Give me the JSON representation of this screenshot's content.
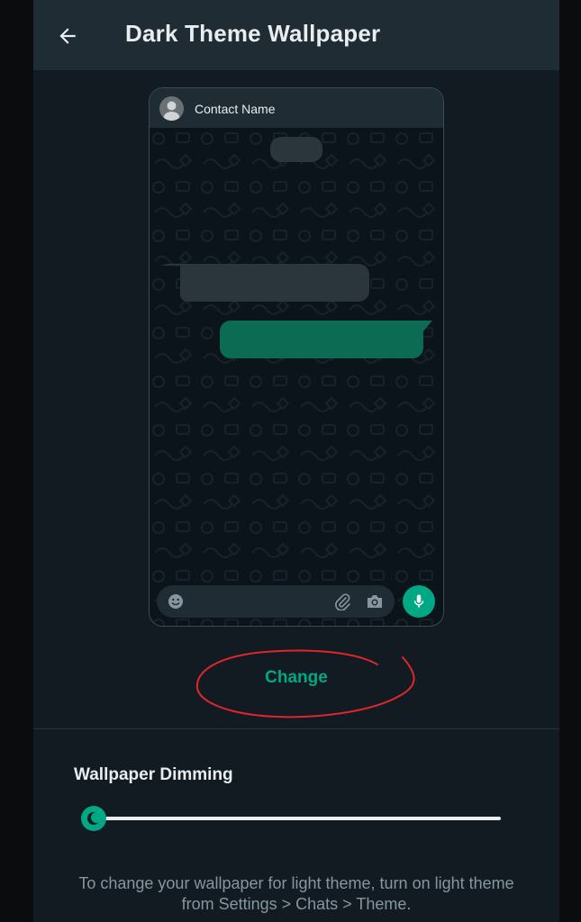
{
  "header": {
    "title": "Dark Theme Wallpaper",
    "back_icon": "arrow-back-icon"
  },
  "preview": {
    "contact_name": "Contact Name",
    "avatar_icon": "person-icon",
    "composer_icons": [
      "emoji-icon",
      "attach-icon",
      "camera-icon"
    ],
    "send_icon": "mic-icon"
  },
  "actions": {
    "change_label": "Change"
  },
  "dimming": {
    "label": "Wallpaper Dimming",
    "value_fraction": 0
  },
  "footer": {
    "note": "To change your wallpaper for light theme, turn on light theme from Settings > Chats > Theme."
  },
  "colors": {
    "accent": "#00a884",
    "background": "#121b22",
    "appbar": "#1f2c34",
    "annotation": "#e0262a"
  }
}
